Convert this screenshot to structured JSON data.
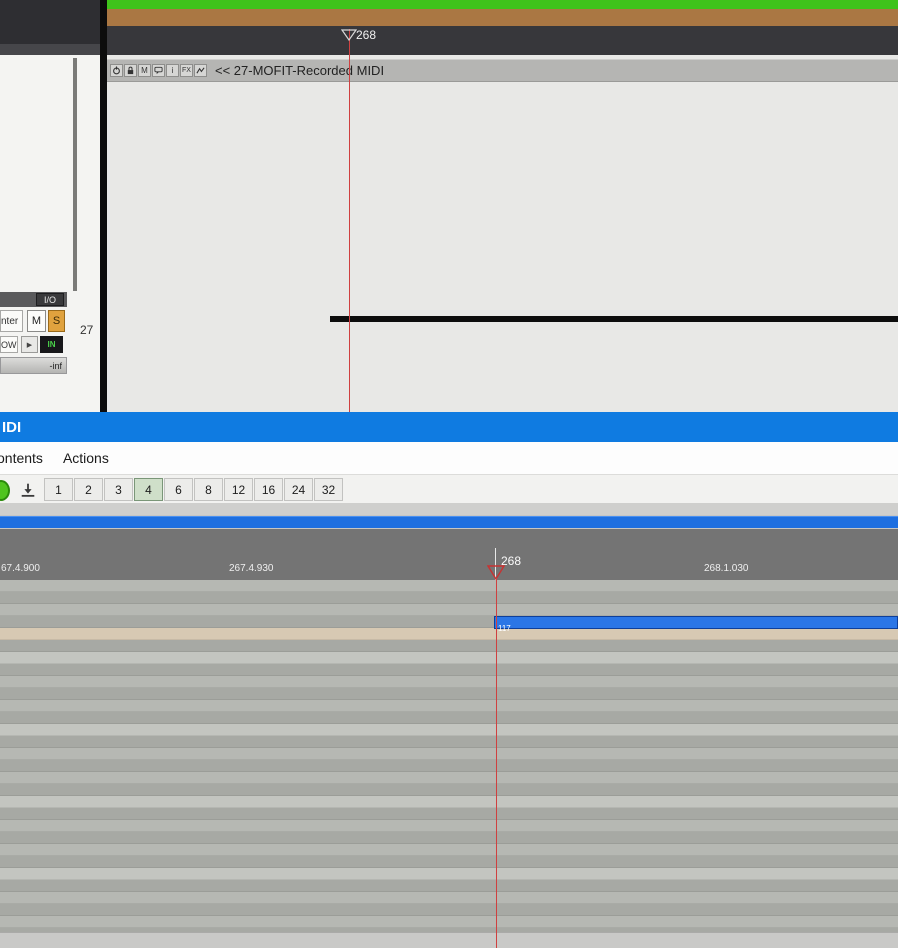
{
  "arrange": {
    "marker_label": "268",
    "track_header": {
      "title": "<< 27-MOFIT-Recorded MIDI",
      "icons": [
        "power-icon",
        "lock-icon",
        "mute-icon",
        "notes-icon",
        "info-icon",
        "fx-icon",
        "envelope-icon"
      ],
      "mute_glyph": "M",
      "info_glyph": "i",
      "fx_glyph": "FX"
    },
    "tcp": {
      "io": "I/O",
      "route_partial": "nter",
      "mute": "M",
      "solo": "S",
      "name_partial": "OW",
      "play_glyph": "▶",
      "meter": "IN",
      "volume": "-inf",
      "track_number": "27"
    }
  },
  "editor": {
    "title_partial": "IDI",
    "menus": {
      "contents_partial": "ontents",
      "actions": "Actions"
    },
    "toolbar": {
      "divisions": [
        "1",
        "2",
        "3",
        "4",
        "6",
        "8",
        "12",
        "16",
        "24",
        "32"
      ],
      "active": "4"
    },
    "ruler": {
      "label_left": "67.4.900",
      "label_mid": "267.4.930",
      "cursor": "268",
      "label_right": "268.1.030"
    },
    "note": {
      "velocity_label": "117"
    }
  },
  "decor": {
    "accent_blue": "#0f7be1",
    "scrollbar_blue": "#1e6fe0",
    "note_blue": "#2b76e6",
    "playhead_red": "#cf4040",
    "item_green": "#3fc31b",
    "item_brown": "#aa7743",
    "solo_orange": "#e0a23e",
    "rows": {
      "count": 30,
      "height": 12,
      "light": "#b6b8b3",
      "dark": "#a7a9a4",
      "accent_every": 6,
      "accent": "#c3c5c0",
      "tan_index": 4,
      "tan": "#d7c9b3"
    }
  }
}
